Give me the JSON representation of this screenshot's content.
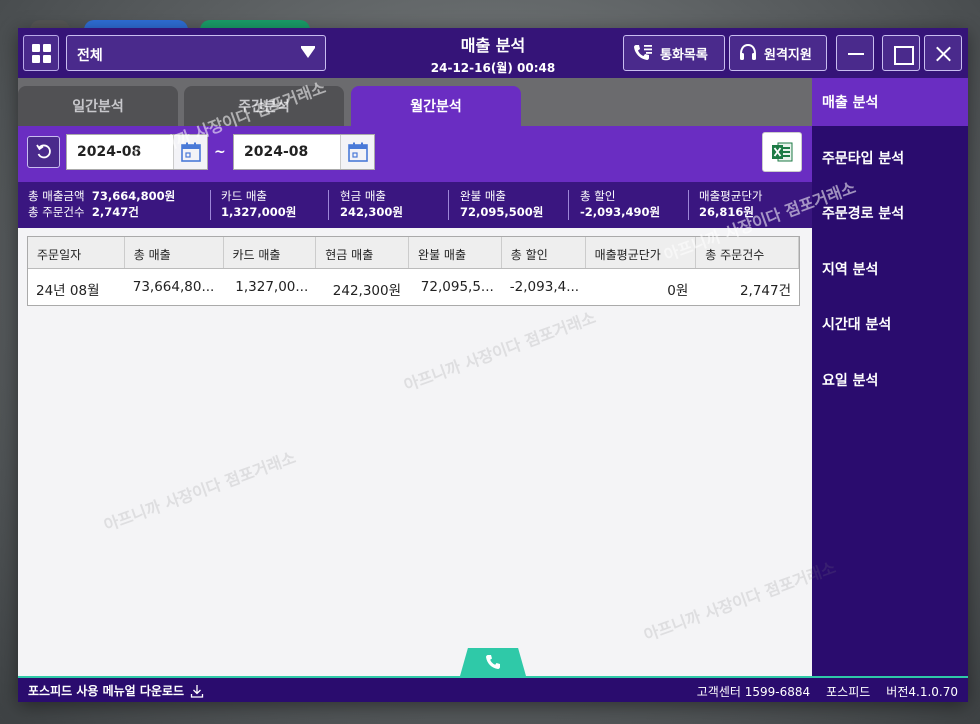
{
  "titlebar": {
    "store_select": "전체",
    "title": "매출 분석",
    "datetime": "24-12-16(월) 00:48",
    "call_list_label": "통화목록",
    "remote_support_label": "원격지원"
  },
  "tabs": [
    {
      "label": "일간분석",
      "active": false
    },
    {
      "label": "주간분석",
      "active": false
    },
    {
      "label": "월간분석",
      "active": true
    }
  ],
  "filter": {
    "date_from": "2024-08",
    "separator": "~",
    "date_to": "2024-08"
  },
  "summary": {
    "total_sales_label": "총 매출금액",
    "total_sales": "73,664,800원",
    "total_orders_label": "총 주문건수",
    "total_orders": "2,747건",
    "card_label": "카드 매출",
    "card": "1,327,000원",
    "cash_label": "현금 매출",
    "cash": "242,300원",
    "prepaid_label": "완불 매출",
    "prepaid": "72,095,500원",
    "discount_label": "총 할인",
    "discount": "-2,093,490원",
    "avg_label": "매출평균단가",
    "avg": "26,816원"
  },
  "table": {
    "headers": [
      "주문일자",
      "총 매출",
      "카드 매출",
      "현금 매출",
      "완불 매출",
      "총 할인",
      "매출평균단가",
      "총 주문건수"
    ],
    "rows": [
      [
        "24년 08월",
        "73,664,80...",
        "1,327,00...",
        "242,300원",
        "72,095,5...",
        "-2,093,4...",
        "0원",
        "2,747건"
      ]
    ]
  },
  "sidebar": {
    "items": [
      {
        "label": "매출 분석",
        "active": true
      },
      {
        "label": "주문타입 분석",
        "active": false
      },
      {
        "label": "주문경로 분석",
        "active": false
      },
      {
        "label": "지역 분석",
        "active": false
      },
      {
        "label": "시간대 분석",
        "active": false
      },
      {
        "label": "요일 분석",
        "active": false
      }
    ]
  },
  "footer": {
    "manual_download": "포스피드 사용 메뉴얼 다운로드",
    "customer_center": "고객센터 1599-6884",
    "brand": "포스피드",
    "version": "버전4.1.0.70"
  },
  "watermark": "아프니까 사장이다 점포거래소",
  "colors": {
    "titlebar": "#351478",
    "accent_purple": "#6a2dc2",
    "sidebar": "#2a0c6e",
    "teal": "#2fc9a8"
  }
}
